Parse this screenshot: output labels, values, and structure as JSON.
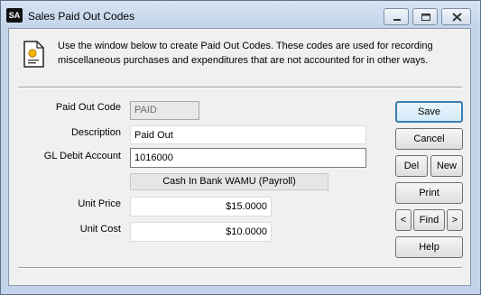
{
  "window": {
    "icon_text": "SA",
    "title": "Sales Paid Out Codes"
  },
  "info": {
    "text": "Use the window below to create Paid Out Codes. These codes are used for recording miscellaneous purchases and expenditures that are not accounted for in other ways."
  },
  "form": {
    "paid_out_code": {
      "label": "Paid Out Code",
      "value": "PAID"
    },
    "description": {
      "label": "Description",
      "value": "Paid Out"
    },
    "gl_debit_account": {
      "label": "GL Debit Account",
      "value": "1016000",
      "account_name": "Cash In Bank WAMU (Payroll)"
    },
    "unit_price": {
      "label": "Unit Price",
      "value": "$15.0000"
    },
    "unit_cost": {
      "label": "Unit Cost",
      "value": "$10.0000"
    }
  },
  "buttons": {
    "save": "Save",
    "cancel": "Cancel",
    "del": "Del",
    "new": "New",
    "print": "Print",
    "prev": "<",
    "find": "Find",
    "next": ">",
    "help": "Help"
  },
  "colors": {
    "titlebar": "#c3d4ea",
    "default_button_border": "#3c7fb1"
  }
}
